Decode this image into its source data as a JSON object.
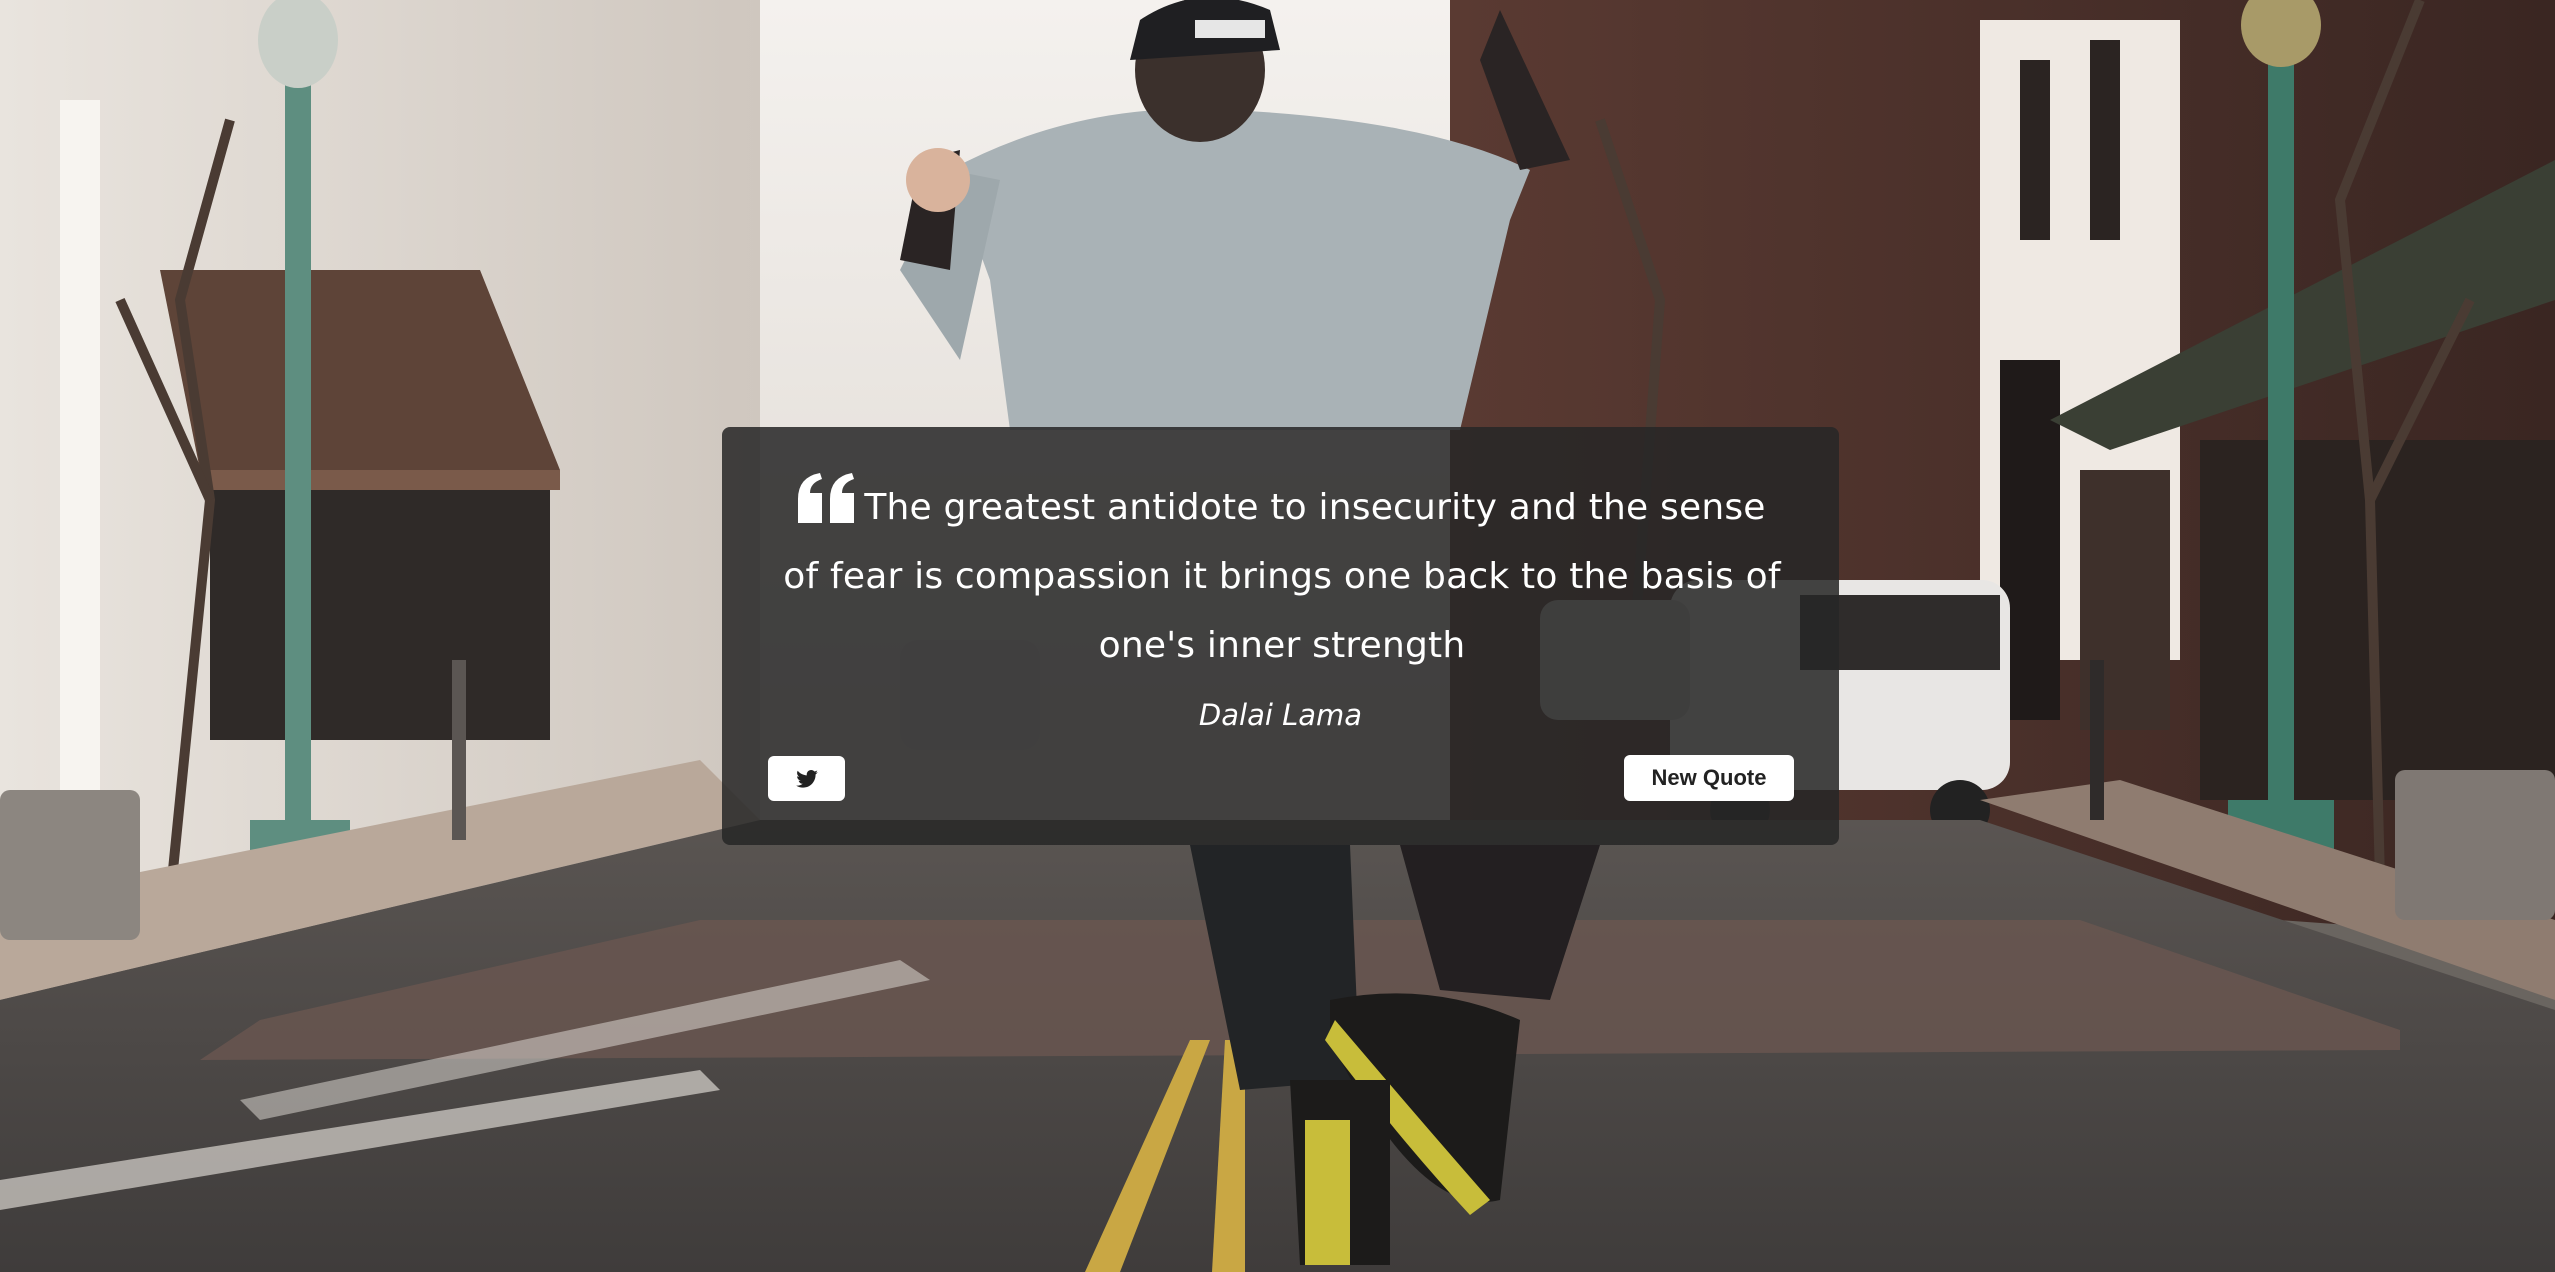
{
  "quote": {
    "text": "The greatest antidote to insecurity and the sense of fear is compassion it brings one back to the basis of one's inner strength",
    "author": "Dalai Lama"
  },
  "actions": {
    "tweet_icon": "twitter-icon",
    "new_quote_label": "New Quote"
  },
  "colors": {
    "card_background": "#262626",
    "button_background": "#ffffff",
    "text": "#ffffff",
    "button_text": "#222222"
  },
  "background": {
    "icon": "street-photo-background"
  }
}
